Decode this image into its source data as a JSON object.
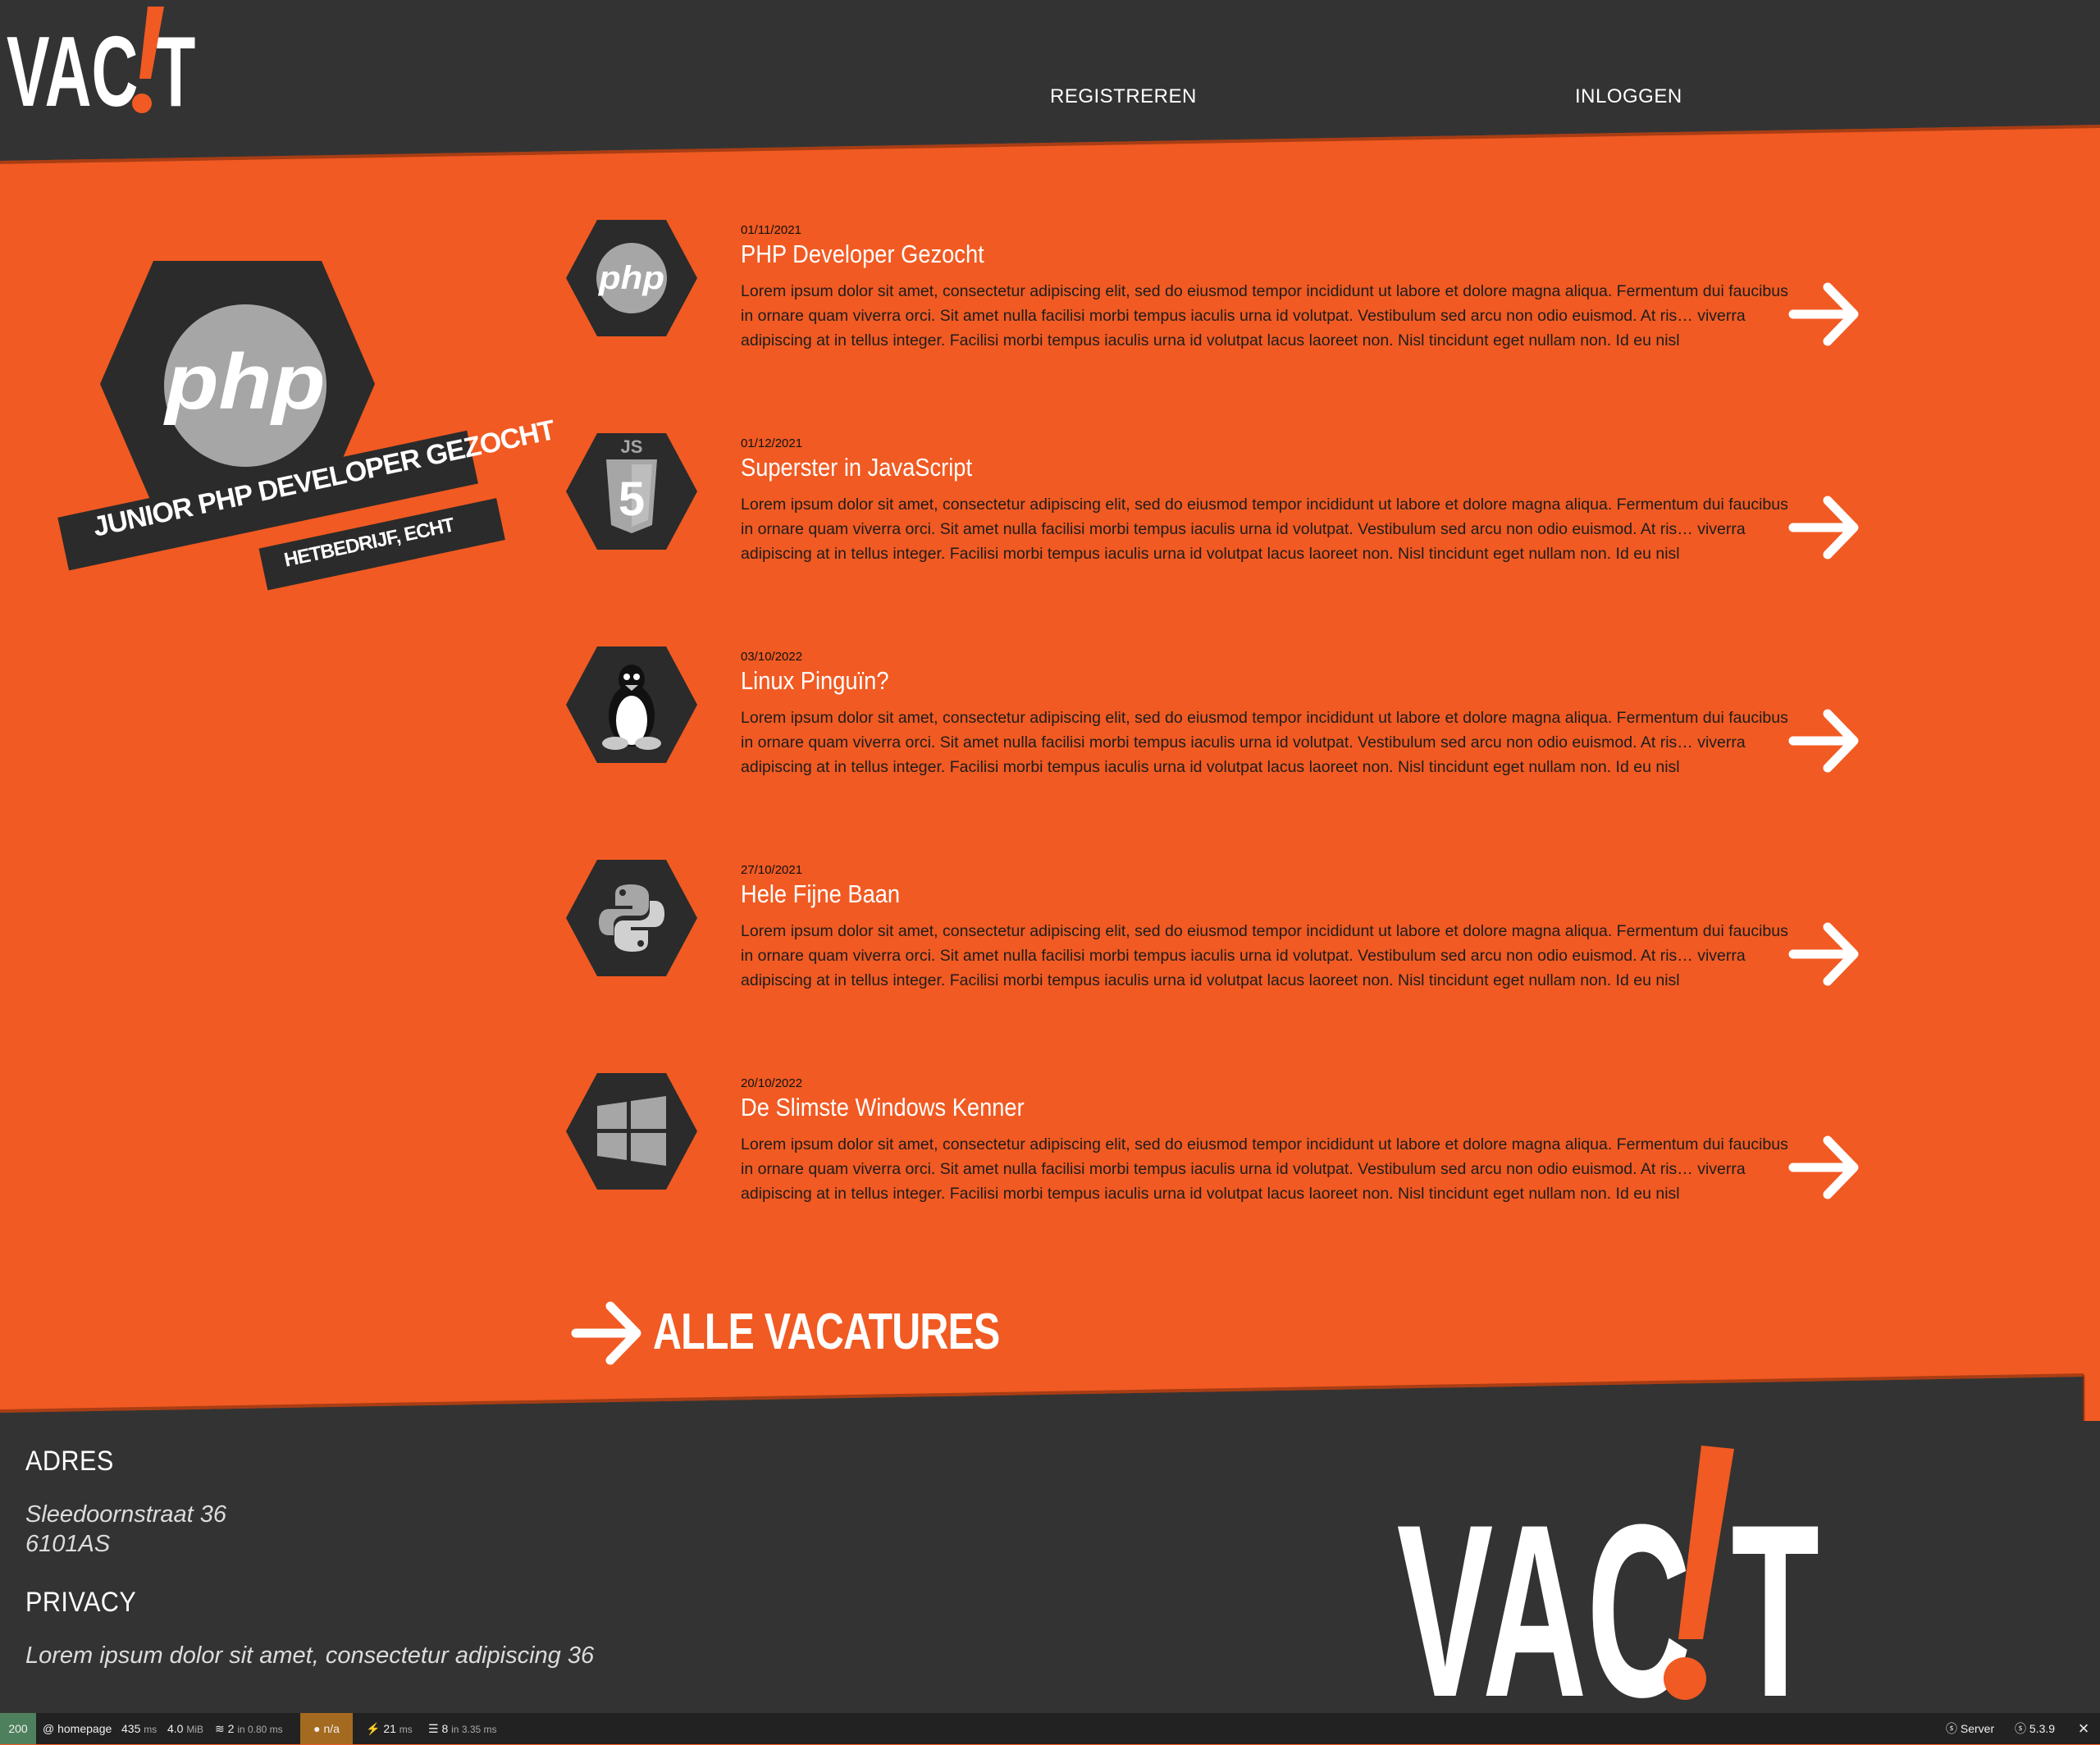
{
  "header": {
    "logo_text": "VAC!T",
    "nav": {
      "register": "REGISTREREN",
      "login": "INLOGGEN"
    }
  },
  "featured": {
    "icon": "php-logo-icon",
    "title": "JUNIOR PHP DEVELOPER GEZOCHT",
    "company": "HETBEDRIJF, ECHT"
  },
  "jobs": [
    {
      "date": "01/11/2021",
      "title": "PHP Developer Gezocht",
      "icon": "php-icon",
      "description": "Lorem ipsum dolor sit amet, consectetur adipiscing elit, sed do eiusmod tempor incididunt ut labore et dolore magna aliqua. Fermentum dui faucibus in ornare quam viverra orci. Sit amet nulla facilisi morbi tempus iaculis urna id volutpat. Vestibulum sed arcu non odio euismod. At ris… viverra adipiscing at in tellus integer. Facilisi morbi tempus iaculis urna id volutpat lacus laoreet non. Nisl tincidunt eget nullam non. Id eu nisl"
    },
    {
      "date": "01/12/2021",
      "title": "Superster in JavaScript",
      "icon": "js-shield-icon",
      "description": "Lorem ipsum dolor sit amet, consectetur adipiscing elit, sed do eiusmod tempor incididunt ut labore et dolore magna aliqua. Fermentum dui faucibus in ornare quam viverra orci. Sit amet nulla facilisi morbi tempus iaculis urna id volutpat. Vestibulum sed arcu non odio euismod. At ris… viverra adipiscing at in tellus integer. Facilisi morbi tempus iaculis urna id volutpat lacus laoreet non. Nisl tincidunt eget nullam non. Id eu nisl"
    },
    {
      "date": "03/10/2022",
      "title": "Linux Pinguïn?",
      "icon": "linux-penguin-icon",
      "description": "Lorem ipsum dolor sit amet, consectetur adipiscing elit, sed do eiusmod tempor incididunt ut labore et dolore magna aliqua. Fermentum dui faucibus in ornare quam viverra orci. Sit amet nulla facilisi morbi tempus iaculis urna id volutpat. Vestibulum sed arcu non odio euismod. At ris… viverra adipiscing at in tellus integer. Facilisi morbi tempus iaculis urna id volutpat lacus laoreet non. Nisl tincidunt eget nullam non. Id eu nisl"
    },
    {
      "date": "27/10/2021",
      "title": "Hele Fijne Baan",
      "icon": "python-icon",
      "description": "Lorem ipsum dolor sit amet, consectetur adipiscing elit, sed do eiusmod tempor incididunt ut labore et dolore magna aliqua. Fermentum dui faucibus in ornare quam viverra orci. Sit amet nulla facilisi morbi tempus iaculis urna id volutpat. Vestibulum sed arcu non odio euismod. At ris… viverra adipiscing at in tellus integer. Facilisi morbi tempus iaculis urna id volutpat lacus laoreet non. Nisl tincidunt eget nullam non. Id eu nisl"
    },
    {
      "date": "20/10/2022",
      "title": "De Slimste Windows Kenner",
      "icon": "windows-icon",
      "description": "Lorem ipsum dolor sit amet, consectetur adipiscing elit, sed do eiusmod tempor incididunt ut labore et dolore magna aliqua. Fermentum dui faucibus in ornare quam viverra orci. Sit amet nulla facilisi morbi tempus iaculis urna id volutpat. Vestibulum sed arcu non odio euismod. At ris… viverra adipiscing at in tellus integer. Facilisi morbi tempus iaculis urna id volutpat lacus laoreet non. Nisl tincidunt eget nullam non. Id eu nisl"
    }
  ],
  "all_vacatures": "ALLE VACATURES",
  "footer": {
    "adres_heading": "ADRES",
    "street": "Sleedoornstraat 36",
    "zip": "6101AS",
    "privacy_heading": "PRIVACY",
    "privacy_text": "Lorem ipsum dolor sit amet, consectetur adipiscing 36",
    "logo_text": "VAC!T"
  },
  "debug_toolbar": {
    "status": "200",
    "route": "homepage",
    "time_value": "435",
    "time_unit": "ms",
    "memory_value": "4.0",
    "memory_unit": "MiB",
    "cache_value": "2",
    "cache_detail": "in 0.80 ms",
    "user": "n/a",
    "events_value": "21",
    "events_unit": "ms",
    "db_value": "8",
    "db_detail": "in 3.35 ms",
    "server": "Server",
    "version": "5.3.9"
  },
  "colors": {
    "accent": "#f15a22",
    "dark": "#333333",
    "icon_gray": "#a6a6a6",
    "toolbar": "#222222"
  }
}
